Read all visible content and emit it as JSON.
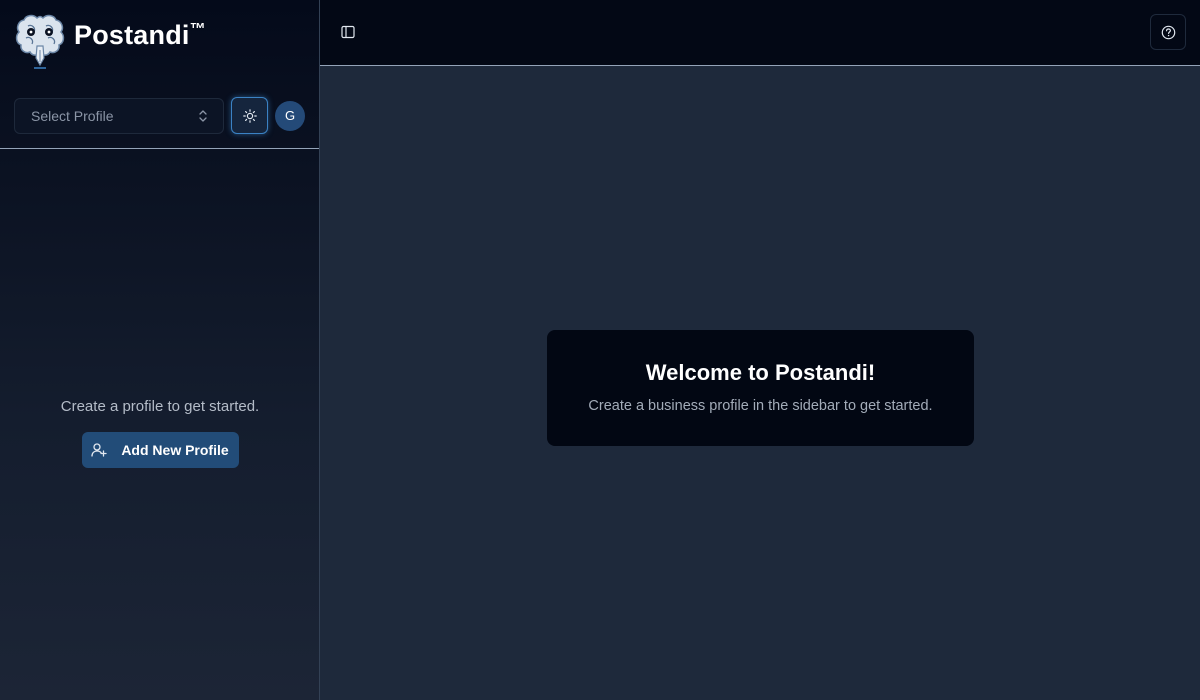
{
  "brand": {
    "name": "Postandi",
    "trademark": "™",
    "logo_icon": "brain-pen-logo"
  },
  "sidebar": {
    "profile_select": {
      "placeholder": "Select Profile",
      "icon": "chevron-updown-icon"
    },
    "theme_toggle": {
      "icon": "sun-icon"
    },
    "avatar": {
      "initial": "G"
    },
    "empty_state": {
      "text": "Create a profile to get started.",
      "button_label": "Add New Profile",
      "button_icon": "user-plus-icon"
    }
  },
  "topbar": {
    "toggle_icon": "panel-left-icon",
    "help_icon": "help-circle-icon"
  },
  "main": {
    "welcome": {
      "title": "Welcome to Postandi!",
      "subtitle": "Create a business profile in the sidebar to get started."
    }
  },
  "colors": {
    "background": "#1e293b",
    "sidebar_top": "#040a1a",
    "topbar": "#030815",
    "accent": "#224c78",
    "card": "#020713"
  }
}
